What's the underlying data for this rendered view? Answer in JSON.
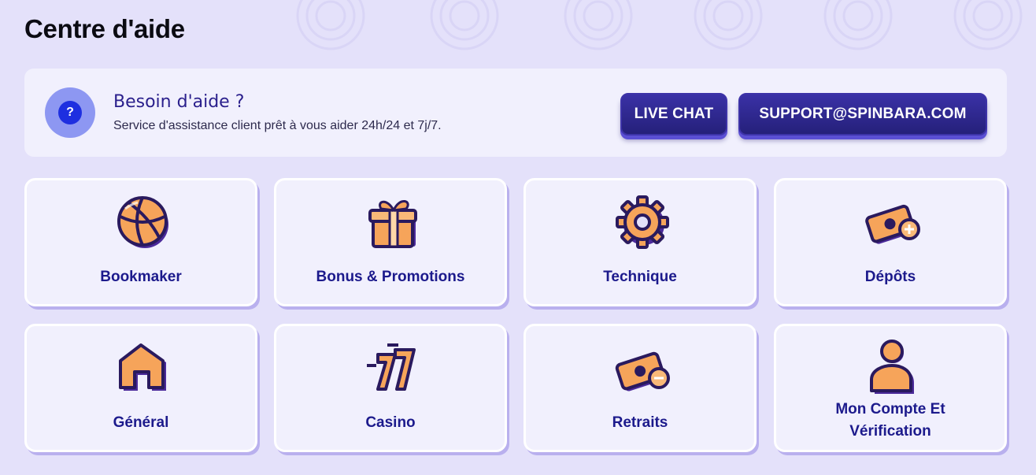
{
  "page": {
    "title": "Centre d'aide"
  },
  "banner": {
    "title": "Besoin d'aide ?",
    "subtitle": "Service d'assistance client prêt à vous aider 24h/24 et 7j/7.",
    "live_chat_label": "LIVE CHAT",
    "support_email_label": "SUPPORT@SPINBARA.COM"
  },
  "categories": [
    {
      "label": "Bookmaker",
      "icon": "basketball-icon"
    },
    {
      "label": "Bonus & Promotions",
      "icon": "gift-icon"
    },
    {
      "label": "Technique",
      "icon": "gear-icon"
    },
    {
      "label": "Dépôts",
      "icon": "money-plus-icon"
    },
    {
      "label": "Général",
      "icon": "home-icon"
    },
    {
      "label": "Casino",
      "icon": "seven-seven-icon"
    },
    {
      "label": "Retraits",
      "icon": "money-minus-icon"
    },
    {
      "label": "Mon Compte Et Vérification",
      "label_line1": "Mon Compte Et",
      "label_line2": "Vérification",
      "icon": "user-icon"
    }
  ],
  "colors": {
    "background": "#e4e1fa",
    "accent": "#2f2790",
    "label": "#1c1a8c",
    "icon_orange": "#f6a45a",
    "icon_outline": "#2a1a5e"
  }
}
